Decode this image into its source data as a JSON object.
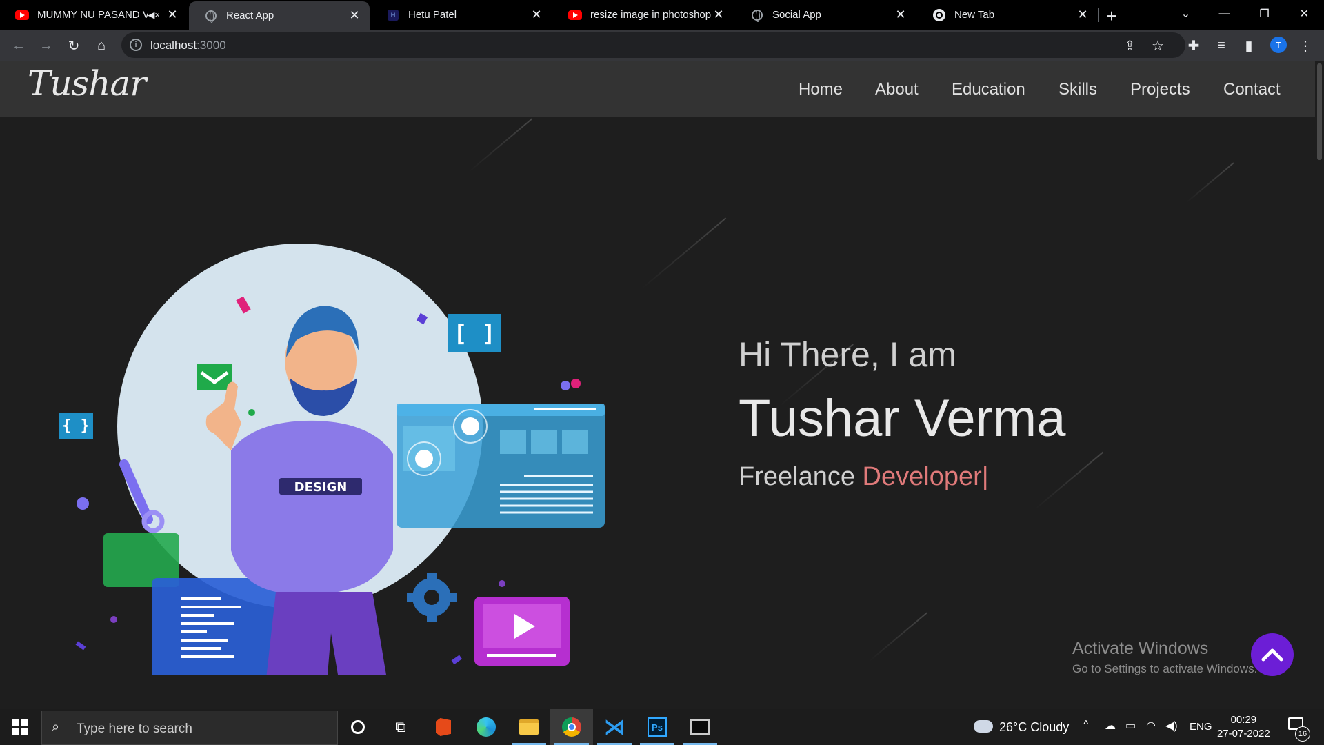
{
  "browser": {
    "tabs": [
      {
        "title": "MUMMY NU PASAND V",
        "favicon": "youtube-icon",
        "muted": true
      },
      {
        "title": "React App",
        "favicon": "globe-icon",
        "active": true
      },
      {
        "title": "Hetu Patel",
        "favicon": "site-icon"
      },
      {
        "title": "resize image in photoshop",
        "favicon": "youtube-icon"
      },
      {
        "title": "Social App",
        "favicon": "globe-icon"
      },
      {
        "title": "New Tab",
        "favicon": "chrome-icon"
      }
    ],
    "address": {
      "host": "localhost",
      "port": ":3000"
    },
    "profile_initial": "T"
  },
  "site": {
    "logo": "Tushar",
    "nav": [
      "Home",
      "About",
      "Education",
      "Skills",
      "Projects",
      "Contact"
    ],
    "hero": {
      "greeting": "Hi There, I am",
      "name": "Tushar Verma",
      "role_prefix": "Freelance ",
      "role_word": "Developer|"
    },
    "illustration_label": "DESIGN"
  },
  "watermark": {
    "title": "Activate Windows",
    "subtitle": "Go to Settings to activate Windows."
  },
  "taskbar": {
    "search_placeholder": "Type here to search",
    "weather": "26°C  Cloudy",
    "language": "ENG",
    "time": "00:29",
    "date": "27-07-2022",
    "notifications": "16"
  },
  "colors": {
    "accent_role": "#e07a7a",
    "scroll_button": "#6c1ed6",
    "navbar": "#333333"
  }
}
